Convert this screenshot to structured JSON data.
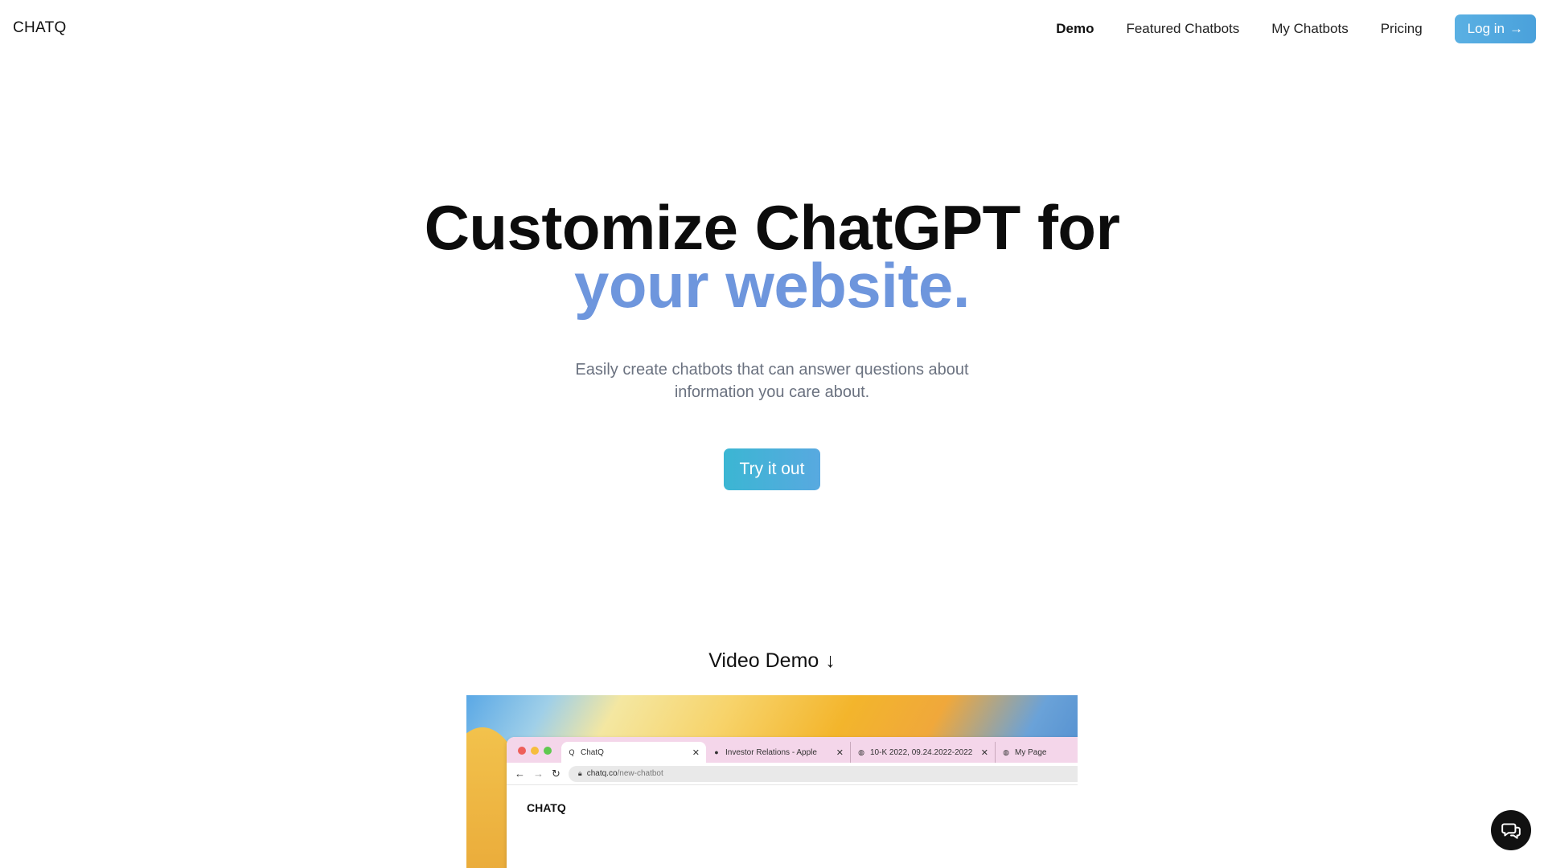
{
  "brand": "CHATQ",
  "nav": {
    "links": [
      "Demo",
      "Featured Chatbots",
      "My Chatbots",
      "Pricing"
    ],
    "active": "Demo",
    "login_label": "Log in",
    "login_arrow": "→"
  },
  "hero": {
    "title_line1": "Customize ChatGPT for",
    "title_line2": "your website.",
    "subtitle_line1": "Easily create chatbots that can answer questions about",
    "subtitle_line2": "information you care about.",
    "cta_label": "Try it out"
  },
  "video": {
    "heading": "Video Demo",
    "heading_arrow": "↓",
    "browser": {
      "tabs": [
        {
          "title": "ChatQ",
          "active": true
        },
        {
          "title": "Investor Relations - Apple",
          "active": false
        },
        {
          "title": "10-K 2022, 09.24.2022-2022",
          "active": false
        },
        {
          "title": "My Page",
          "active": false
        }
      ],
      "url_host": "chatq.co",
      "url_path": "/new-chatbot",
      "page_logo": "CHATQ"
    }
  },
  "colors": {
    "accent_blue": "#6e96dd",
    "login_bg": "#4aa1db",
    "cta_bg": "#3bb6d3",
    "traffic_red": "#ee5f5a",
    "traffic_yellow": "#f6bd3d",
    "traffic_green": "#5fc94f"
  },
  "icons": {
    "chat_fab": "chat-bubbles-icon"
  }
}
